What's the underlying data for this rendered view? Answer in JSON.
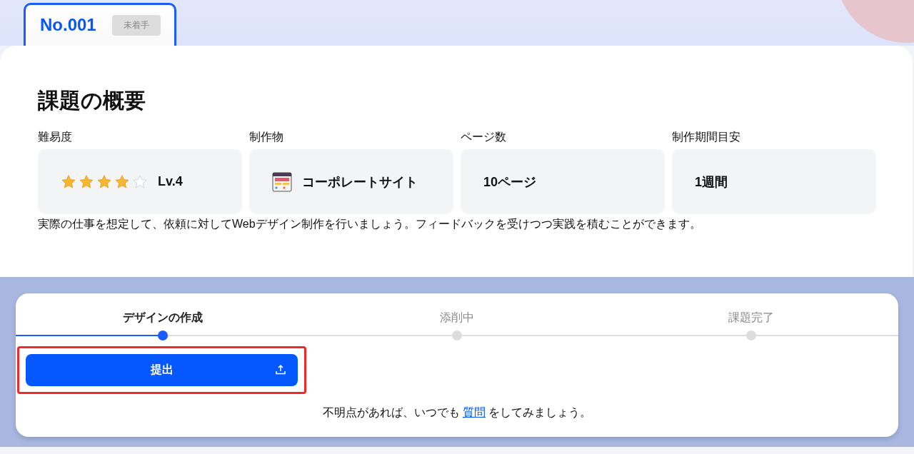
{
  "tab": {
    "number": "No.001",
    "status": "未着手"
  },
  "overview": {
    "title": "課題の概要",
    "items": [
      {
        "kind": "stars",
        "label": "難易度",
        "stars": 4,
        "value": "Lv.4"
      },
      {
        "kind": "product",
        "label": "制作物",
        "value": "コーポレートサイト"
      },
      {
        "kind": "text",
        "label": "ページ数",
        "value": "10ページ"
      },
      {
        "kind": "text",
        "label": "制作期間目安",
        "value": "1週間"
      }
    ],
    "description": "実際の仕事を想定して、依頼に対してWebデザイン制作を行いましょう。フィードバックを受けつつ実践を積むことができます。"
  },
  "steps": [
    {
      "label": "デザインの作成",
      "selected": true
    },
    {
      "label": "添削中",
      "selected": false
    },
    {
      "label": "課題完了",
      "selected": false
    }
  ],
  "submit_button": {
    "label": "提出",
    "highlighted": true
  },
  "help": {
    "before": "不明点があれば、いつでも",
    "link": "質問",
    "after": "をしてみましょう。"
  }
}
